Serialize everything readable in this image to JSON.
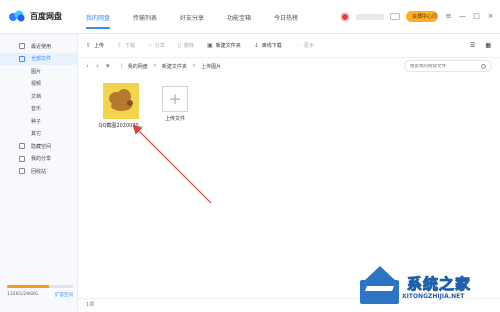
{
  "app": {
    "name": "百度网盘"
  },
  "top_tabs": [
    {
      "label": "我的网盘",
      "active": true
    },
    {
      "label": "传输列表",
      "active": false
    },
    {
      "label": "好友分享",
      "active": false
    },
    {
      "label": "功能宝箱",
      "active": false
    },
    {
      "label": "今日热榜",
      "active": false
    }
  ],
  "user": {
    "member_button": "会员中心"
  },
  "sidebar": {
    "items": [
      {
        "label": "最近使用",
        "icon": "clock-icon",
        "active": false
      },
      {
        "label": "全部文件",
        "icon": "folder-icon",
        "active": true
      },
      {
        "label": "图片",
        "active": false
      },
      {
        "label": "视频",
        "active": false
      },
      {
        "label": "文档",
        "active": false
      },
      {
        "label": "音乐",
        "active": false
      },
      {
        "label": "种子",
        "active": false
      },
      {
        "label": "其它",
        "active": false
      },
      {
        "label": "隐藏空间",
        "icon": "lock-icon",
        "active": false
      },
      {
        "label": "我的分享",
        "icon": "share-icon",
        "active": false
      },
      {
        "label": "回收站",
        "icon": "trash-icon",
        "active": false
      }
    ],
    "storage": {
      "used_text": "1326G/2068G",
      "expand_label": "扩容空间",
      "used_fraction": 0.64
    }
  },
  "toolbar": {
    "upload": "上传",
    "download": "下载",
    "share": "分享",
    "delete": "删除",
    "new_folder": "新建文件夹",
    "offline_download": "离线下载",
    "more": "更多"
  },
  "path": {
    "items": [
      "我的网盘",
      "新建文件夹",
      "上传图片"
    ],
    "search_placeholder": "搜索我的网盘文件"
  },
  "files": [
    {
      "name": "QQ截图2020070...",
      "type": "image"
    },
    {
      "name": "上传文件",
      "type": "upload"
    }
  ],
  "status": {
    "count_text": "1项"
  },
  "watermark": {
    "title": "系统之家",
    "url": "XITONGZHIJIA.NET"
  },
  "colors": {
    "accent": "#3b8cff",
    "member": "#ffb020",
    "annotation": "#d94343"
  }
}
